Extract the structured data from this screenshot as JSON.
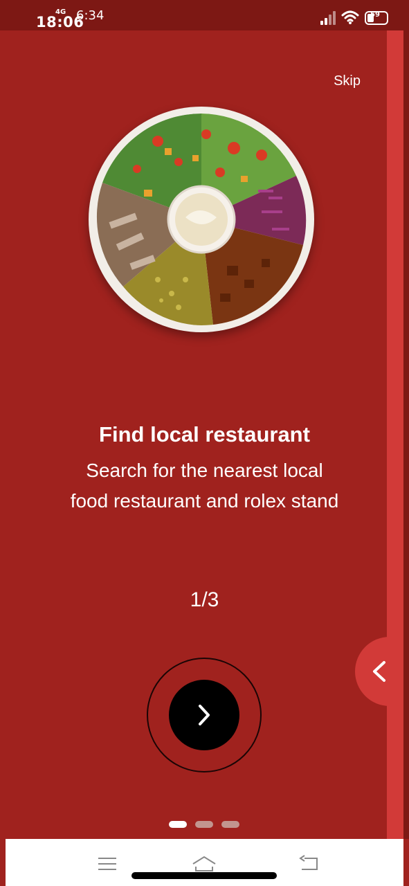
{
  "status_bar": {
    "time": "18:06",
    "secondary_time": "6:34",
    "network": "4G",
    "battery": "59"
  },
  "header": {
    "skip_label": "Skip"
  },
  "onboarding": {
    "title": "Find local restaurant",
    "subtitle_line1": "Search for the nearest local",
    "subtitle_line2": "food restaurant and rolex stand",
    "page_counter": "1/3",
    "current_page": 1,
    "total_pages": 3
  },
  "icons": {
    "next": "chevron-right-icon",
    "back_tab": "chevron-left-icon",
    "image": "food-plate-illustration"
  },
  "colors": {
    "background": "#a0221e",
    "accent_strip": "#d23a38",
    "button": "#000000",
    "text": "#ffffff"
  }
}
